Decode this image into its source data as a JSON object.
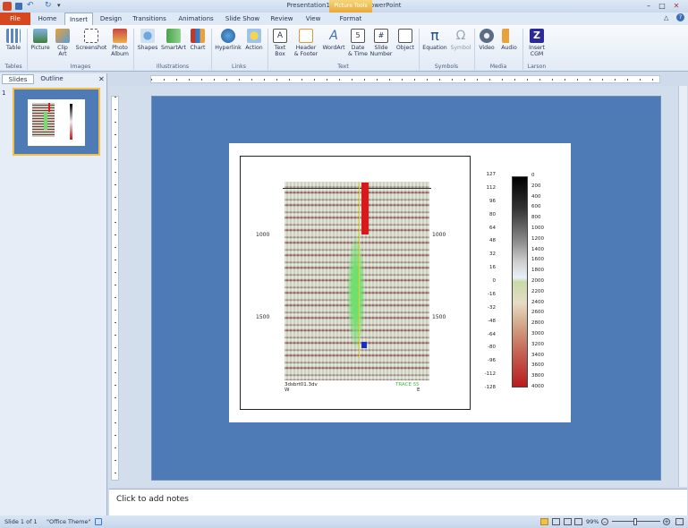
{
  "window": {
    "title": "Presentation1 - Microsoft PowerPoint",
    "context_tab": "Picture Tools"
  },
  "tabs": [
    "File",
    "Home",
    "Insert",
    "Design",
    "Transitions",
    "Animations",
    "Slide Show",
    "Review",
    "View",
    "Format"
  ],
  "ribbon": {
    "buttons": [
      {
        "label": "Table",
        "icon": "table-icon"
      },
      {
        "label": "Picture",
        "icon": "picture-icon"
      },
      {
        "label": "Clip\nArt",
        "icon": "clipart-icon"
      },
      {
        "label": "Screenshot",
        "icon": "screenshot-icon"
      },
      {
        "label": "Photo\nAlbum",
        "icon": "photo-album-icon"
      },
      {
        "label": "Shapes",
        "icon": "shapes-icon"
      },
      {
        "label": "SmartArt",
        "icon": "smartart-icon"
      },
      {
        "label": "Chart",
        "icon": "chart-icon"
      },
      {
        "label": "Hyperlink",
        "icon": "hyperlink-icon"
      },
      {
        "label": "Action",
        "icon": "action-icon"
      },
      {
        "label": "Text\nBox",
        "icon": "textbox-icon"
      },
      {
        "label": "Header\n& Footer",
        "icon": "header-footer-icon"
      },
      {
        "label": "WordArt",
        "icon": "wordart-icon"
      },
      {
        "label": "Date\n& Time",
        "icon": "datetime-icon"
      },
      {
        "label": "Slide\nNumber",
        "icon": "slide-number-icon"
      },
      {
        "label": "Object",
        "icon": "object-icon"
      },
      {
        "label": "Equation",
        "icon": "equation-icon"
      },
      {
        "label": "Symbol",
        "icon": "symbol-icon"
      },
      {
        "label": "Video",
        "icon": "video-icon"
      },
      {
        "label": "Audio",
        "icon": "audio-icon"
      },
      {
        "label": "Insert\nCGM",
        "icon": "cgm-icon"
      }
    ],
    "groups": [
      "Tables",
      "Images",
      "Illustrations",
      "Links",
      "Text",
      "Symbols",
      "Media",
      "Larson"
    ]
  },
  "panel": {
    "tabs": [
      "Slides",
      "Outline"
    ],
    "slide_number": "1"
  },
  "seismic": {
    "depth_labels": [
      "1000",
      "1500"
    ],
    "bottom_left": "3dsbrt01.3dv",
    "bottom_left2": "W",
    "bottom_right": "TRACE 55",
    "bottom_right2": "E",
    "scale_left": [
      "127",
      "112",
      "96",
      "80",
      "64",
      "48",
      "32",
      "16",
      "0",
      "-16",
      "-32",
      "-48",
      "-64",
      "-80",
      "-96",
      "-112",
      "-128"
    ],
    "scale_right": [
      "0",
      "200",
      "400",
      "600",
      "800",
      "1000",
      "1200",
      "1400",
      "1600",
      "1800",
      "2000",
      "2200",
      "2400",
      "2600",
      "2800",
      "3000",
      "3200",
      "3400",
      "3600",
      "3800",
      "4000"
    ]
  },
  "notes": {
    "placeholder": "Click to add notes"
  },
  "status": {
    "slide": "Slide 1 of 1",
    "theme": "\"Office Theme\"",
    "zoom": "99%"
  }
}
